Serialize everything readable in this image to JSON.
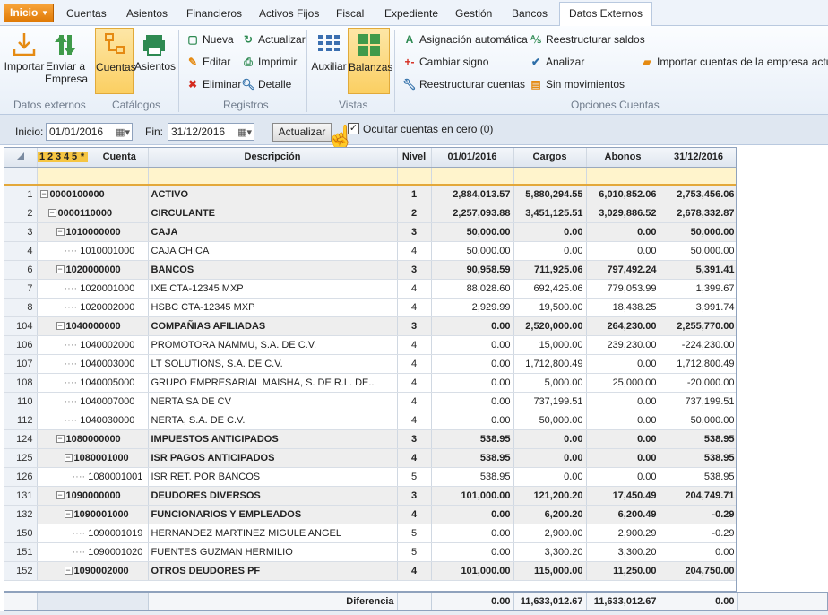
{
  "menu": {
    "inicio": "Inicio",
    "tabs": [
      "Cuentas",
      "Asientos",
      "Financieros",
      "Activos Fijos",
      "Fiscal",
      "Expediente",
      "Gestión",
      "Bancos",
      "Datos Externos"
    ],
    "active_tab": "Datos Externos"
  },
  "ribbon": {
    "datos_externos": {
      "label": "Datos externos",
      "importar": "Importar",
      "enviar": "Enviar a",
      "enviar2": "Empresa"
    },
    "catalogos": {
      "label": "Catálogos",
      "cuentas": "Cuentas",
      "asientos": "Asientos"
    },
    "registros": {
      "label": "Registros",
      "nueva": "Nueva",
      "editar": "Editar",
      "eliminar": "Eliminar",
      "actualizar": "Actualizar",
      "imprimir": "Imprimir",
      "detalle": "Detalle"
    },
    "vistas": {
      "label": "Vistas",
      "auxiliar": "Auxiliar",
      "balanzas": "Balanzas"
    },
    "opciones": {
      "label": "Opciones Cuentas",
      "asignacion": "Asignación automática",
      "cambiar": "Cambiar signo",
      "reestructurar_cuentas": "Reestructurar cuentas",
      "reestructurar_saldos": "Reestructurar saldos",
      "analizar": "Analizar",
      "sin_movimientos": "Sin movimientos",
      "importar_empresa": "Importar cuentas de la empresa actual"
    }
  },
  "filter": {
    "inicio_label": "Inicio:",
    "inicio_value": "01/01/2016",
    "fin_label": "Fin:",
    "fin_value": "31/12/2016",
    "actualizar": "Actualizar",
    "ocultar_label": "Ocultar cuentas en cero (0)",
    "ocultar_checked": "✓"
  },
  "grid": {
    "level_header": [
      "1",
      "2",
      "3",
      "4",
      "5",
      "*"
    ],
    "columns": {
      "cuenta": "Cuenta",
      "descripcion": "Descripción",
      "nivel": "Nivel",
      "inicial": "01/01/2016",
      "cargos": "Cargos",
      "abonos": "Abonos",
      "final": "31/12/2016"
    },
    "rows": [
      {
        "rn": "1",
        "depth": 0,
        "exp": true,
        "cuenta": "0000100000",
        "desc": "ACTIVO",
        "nivel": "1",
        "ini": "2,884,013.57",
        "car": "5,880,294.55",
        "abo": "6,010,852.06",
        "fin": "2,753,456.06",
        "bold": true
      },
      {
        "rn": "2",
        "depth": 1,
        "exp": true,
        "cuenta": "0000110000",
        "desc": "CIRCULANTE",
        "nivel": "2",
        "ini": "2,257,093.88",
        "car": "3,451,125.51",
        "abo": "3,029,886.52",
        "fin": "2,678,332.87",
        "bold": true
      },
      {
        "rn": "3",
        "depth": 2,
        "exp": true,
        "cuenta": "1010000000",
        "desc": "CAJA",
        "nivel": "3",
        "ini": "50,000.00",
        "car": "0.00",
        "abo": "0.00",
        "fin": "50,000.00",
        "bold": true
      },
      {
        "rn": "4",
        "depth": 3,
        "exp": false,
        "cuenta": "1010001000",
        "desc": "CAJA CHICA",
        "nivel": "4",
        "ini": "50,000.00",
        "car": "0.00",
        "abo": "0.00",
        "fin": "50,000.00",
        "bold": false
      },
      {
        "rn": "6",
        "depth": 2,
        "exp": true,
        "cuenta": "1020000000",
        "desc": "BANCOS",
        "nivel": "3",
        "ini": "90,958.59",
        "car": "711,925.06",
        "abo": "797,492.24",
        "fin": "5,391.41",
        "bold": true
      },
      {
        "rn": "7",
        "depth": 3,
        "exp": false,
        "cuenta": "1020001000",
        "desc": "IXE CTA-12345 MXP",
        "nivel": "4",
        "ini": "88,028.60",
        "car": "692,425.06",
        "abo": "779,053.99",
        "fin": "1,399.67",
        "bold": false
      },
      {
        "rn": "8",
        "depth": 3,
        "exp": false,
        "cuenta": "1020002000",
        "desc": "HSBC CTA-12345 MXP",
        "nivel": "4",
        "ini": "2,929.99",
        "car": "19,500.00",
        "abo": "18,438.25",
        "fin": "3,991.74",
        "bold": false
      },
      {
        "rn": "104",
        "depth": 2,
        "exp": true,
        "cuenta": "1040000000",
        "desc": "COMPAÑIAS AFILIADAS",
        "nivel": "3",
        "ini": "0.00",
        "car": "2,520,000.00",
        "abo": "264,230.00",
        "fin": "2,255,770.00",
        "bold": true
      },
      {
        "rn": "106",
        "depth": 3,
        "exp": false,
        "cuenta": "1040002000",
        "desc": "PROMOTORA NAMMU, S.A. DE C.V.",
        "nivel": "4",
        "ini": "0.00",
        "car": "15,000.00",
        "abo": "239,230.00",
        "fin": "-224,230.00",
        "bold": false
      },
      {
        "rn": "107",
        "depth": 3,
        "exp": false,
        "cuenta": "1040003000",
        "desc": "LT SOLUTIONS, S.A. DE C.V.",
        "nivel": "4",
        "ini": "0.00",
        "car": "1,712,800.49",
        "abo": "0.00",
        "fin": "1,712,800.49",
        "bold": false
      },
      {
        "rn": "108",
        "depth": 3,
        "exp": false,
        "cuenta": "1040005000",
        "desc": "GRUPO EMPRESARIAL MAISHA, S. DE R.L. DE..",
        "nivel": "4",
        "ini": "0.00",
        "car": "5,000.00",
        "abo": "25,000.00",
        "fin": "-20,000.00",
        "bold": false
      },
      {
        "rn": "110",
        "depth": 3,
        "exp": false,
        "cuenta": "1040007000",
        "desc": "NERTA SA DE CV",
        "nivel": "4",
        "ini": "0.00",
        "car": "737,199.51",
        "abo": "0.00",
        "fin": "737,199.51",
        "bold": false
      },
      {
        "rn": "112",
        "depth": 3,
        "exp": false,
        "cuenta": "1040030000",
        "desc": "NERTA, S.A. DE C.V.",
        "nivel": "4",
        "ini": "0.00",
        "car": "50,000.00",
        "abo": "0.00",
        "fin": "50,000.00",
        "bold": false
      },
      {
        "rn": "124",
        "depth": 2,
        "exp": true,
        "cuenta": "1080000000",
        "desc": "IMPUESTOS ANTICIPADOS",
        "nivel": "3",
        "ini": "538.95",
        "car": "0.00",
        "abo": "0.00",
        "fin": "538.95",
        "bold": true
      },
      {
        "rn": "125",
        "depth": 3,
        "exp": true,
        "cuenta": "1080001000",
        "desc": "ISR PAGOS ANTICIPADOS",
        "nivel": "4",
        "ini": "538.95",
        "car": "0.00",
        "abo": "0.00",
        "fin": "538.95",
        "bold": true
      },
      {
        "rn": "126",
        "depth": 4,
        "exp": false,
        "cuenta": "1080001001",
        "desc": "ISR RET. POR BANCOS",
        "nivel": "5",
        "ini": "538.95",
        "car": "0.00",
        "abo": "0.00",
        "fin": "538.95",
        "bold": false
      },
      {
        "rn": "131",
        "depth": 2,
        "exp": true,
        "cuenta": "1090000000",
        "desc": "DEUDORES DIVERSOS",
        "nivel": "3",
        "ini": "101,000.00",
        "car": "121,200.20",
        "abo": "17,450.49",
        "fin": "204,749.71",
        "bold": true
      },
      {
        "rn": "132",
        "depth": 3,
        "exp": true,
        "cuenta": "1090001000",
        "desc": "FUNCIONARIOS Y EMPLEADOS",
        "nivel": "4",
        "ini": "0.00",
        "car": "6,200.20",
        "abo": "6,200.49",
        "fin": "-0.29",
        "bold": true
      },
      {
        "rn": "150",
        "depth": 4,
        "exp": false,
        "cuenta": "1090001019",
        "desc": "HERNANDEZ MARTINEZ MIGULE ANGEL",
        "nivel": "5",
        "ini": "0.00",
        "car": "2,900.00",
        "abo": "2,900.29",
        "fin": "-0.29",
        "bold": false
      },
      {
        "rn": "151",
        "depth": 4,
        "exp": false,
        "cuenta": "1090001020",
        "desc": "FUENTES GUZMAN HERMILIO",
        "nivel": "5",
        "ini": "0.00",
        "car": "3,300.20",
        "abo": "3,300.20",
        "fin": "0.00",
        "bold": false
      },
      {
        "rn": "152",
        "depth": 3,
        "exp": true,
        "cuenta": "1090002000",
        "desc": "OTROS DEUDORES PF",
        "nivel": "4",
        "ini": "101,000.00",
        "car": "115,000.00",
        "abo": "11,250.00",
        "fin": "204,750.00",
        "bold": true
      }
    ]
  },
  "footer": {
    "label": "Diferencia",
    "ini": "0.00",
    "car": "11,633,012.67",
    "abo": "11,633,012.67",
    "fin": "0.00"
  }
}
